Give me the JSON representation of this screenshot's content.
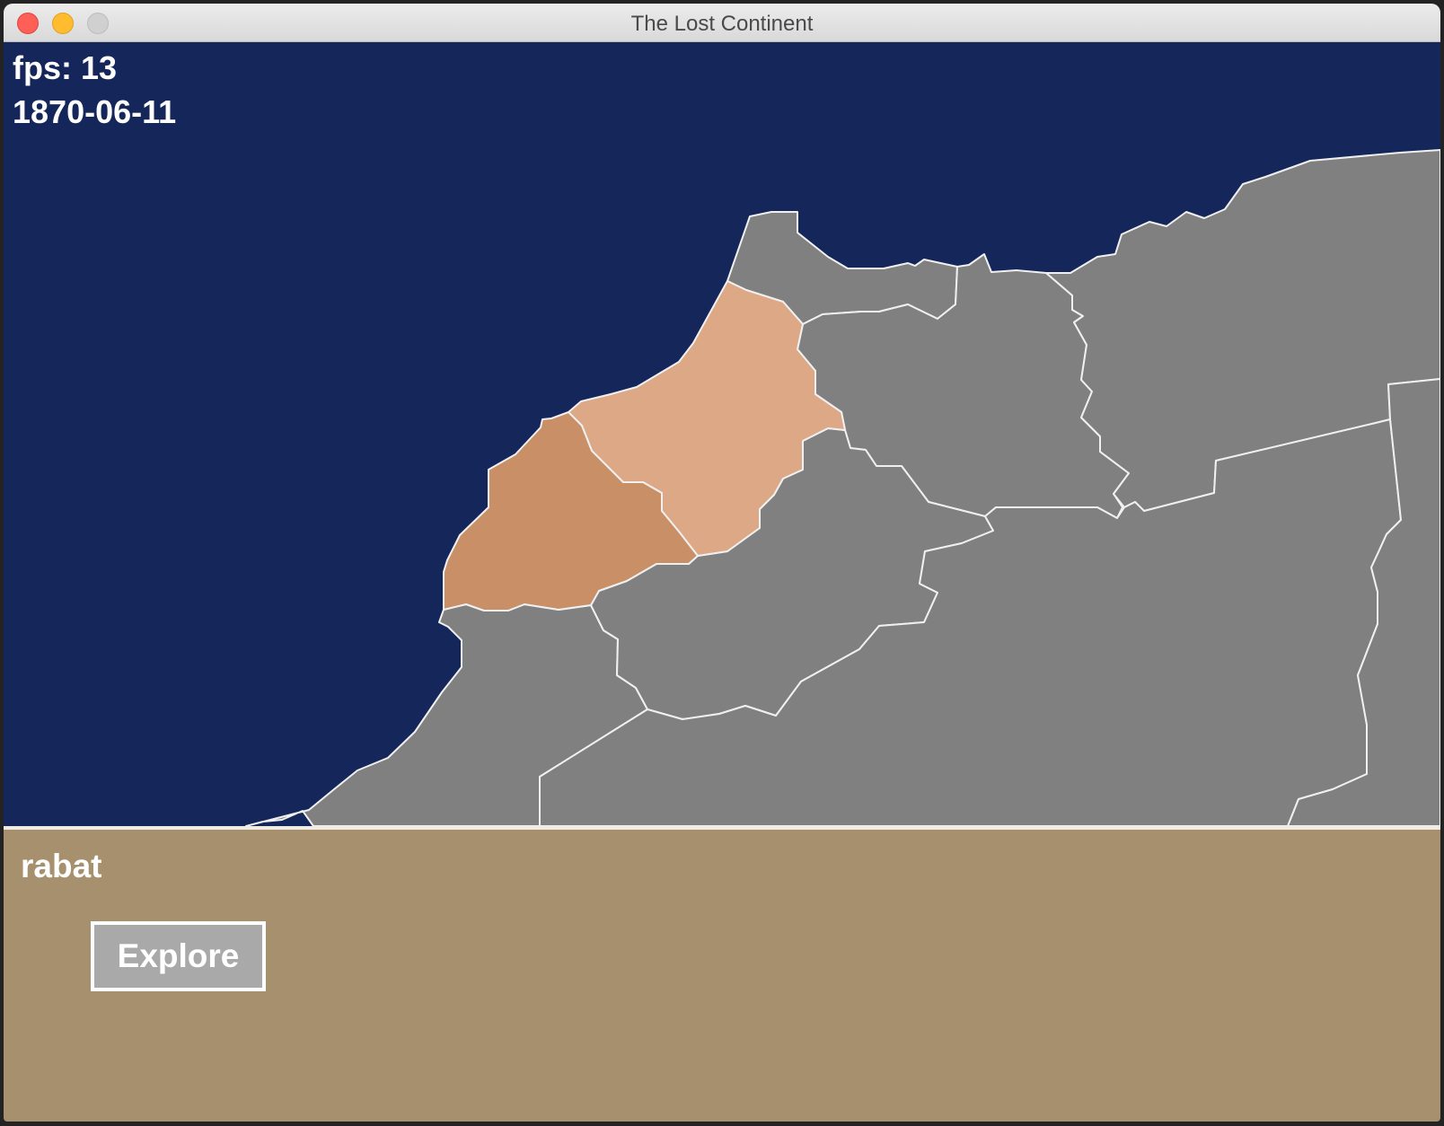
{
  "window": {
    "title": "The Lost Continent"
  },
  "hud": {
    "fps": "fps: 13",
    "date": "1870-06-11"
  },
  "panel": {
    "selected_region": "rabat",
    "explore_label": "Explore"
  },
  "colors": {
    "sea": "#15265a",
    "land": "#808080",
    "region_selected": "#dca886",
    "region_neighbor": "#c99068",
    "border": "#f0f0f0",
    "panel": "#a7906e",
    "button": "#a9a9a9"
  }
}
